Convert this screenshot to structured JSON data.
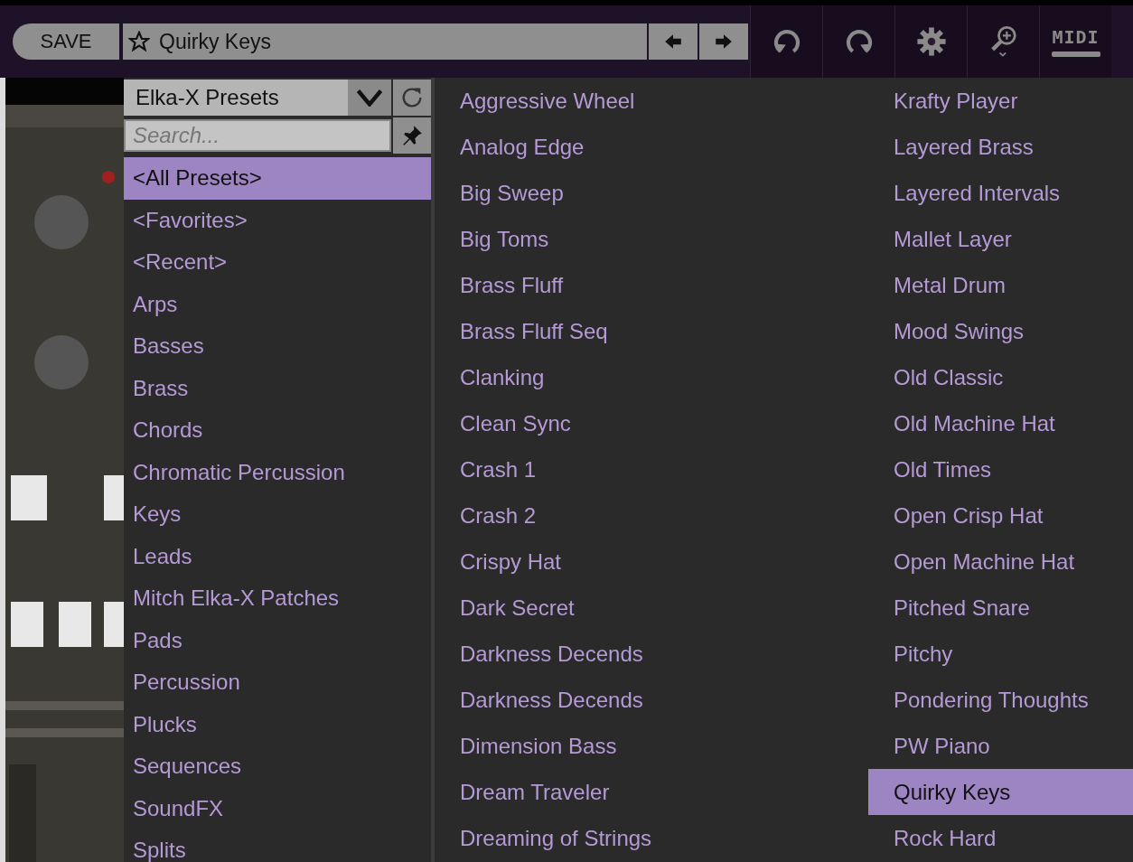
{
  "toolbar": {
    "save": "SAVE",
    "preset_name": "Quirky Keys",
    "midi_label": "MIDI"
  },
  "bank": {
    "label": "Elka-X Presets"
  },
  "search": {
    "placeholder": "Search..."
  },
  "categories": [
    {
      "label": "<All Presets>",
      "selected": true
    },
    {
      "label": "<Favorites>",
      "selected": false
    },
    {
      "label": "<Recent>",
      "selected": false
    },
    {
      "label": "Arps",
      "selected": false
    },
    {
      "label": "Basses",
      "selected": false
    },
    {
      "label": "Brass",
      "selected": false
    },
    {
      "label": "Chords",
      "selected": false
    },
    {
      "label": "Chromatic Percussion",
      "selected": false
    },
    {
      "label": "Keys",
      "selected": false
    },
    {
      "label": "Leads",
      "selected": false
    },
    {
      "label": "Mitch Elka-X Patches",
      "selected": false
    },
    {
      "label": "Pads",
      "selected": false
    },
    {
      "label": "Percussion",
      "selected": false
    },
    {
      "label": "Plucks",
      "selected": false
    },
    {
      "label": "Sequences",
      "selected": false
    },
    {
      "label": "SoundFX",
      "selected": false
    },
    {
      "label": "Splits",
      "selected": false
    }
  ],
  "presets": [
    {
      "label": "Aggressive Wheel",
      "selected": false
    },
    {
      "label": "Analog Edge",
      "selected": false
    },
    {
      "label": "Big Sweep",
      "selected": false
    },
    {
      "label": "Big Toms",
      "selected": false
    },
    {
      "label": "Brass Fluff",
      "selected": false
    },
    {
      "label": "Brass Fluff Seq",
      "selected": false
    },
    {
      "label": "Clanking",
      "selected": false
    },
    {
      "label": "Clean Sync",
      "selected": false
    },
    {
      "label": "Crash 1",
      "selected": false
    },
    {
      "label": "Crash 2",
      "selected": false
    },
    {
      "label": "Crispy Hat",
      "selected": false
    },
    {
      "label": "Dark Secret",
      "selected": false
    },
    {
      "label": "Darkness Decends",
      "selected": false
    },
    {
      "label": "Darkness Decends",
      "selected": false
    },
    {
      "label": "Dimension Bass",
      "selected": false
    },
    {
      "label": "Dream Traveler",
      "selected": false
    },
    {
      "label": "Dreaming of Strings",
      "selected": false
    },
    {
      "label": "Krafty Player",
      "selected": false
    },
    {
      "label": "Layered Brass",
      "selected": false
    },
    {
      "label": "Layered Intervals",
      "selected": false
    },
    {
      "label": "Mallet Layer",
      "selected": false
    },
    {
      "label": "Metal Drum",
      "selected": false
    },
    {
      "label": "Mood Swings",
      "selected": false
    },
    {
      "label": "Old Classic",
      "selected": false
    },
    {
      "label": "Old Machine Hat",
      "selected": false
    },
    {
      "label": "Old Times",
      "selected": false
    },
    {
      "label": "Open Crisp Hat",
      "selected": false
    },
    {
      "label": "Open Machine Hat",
      "selected": false
    },
    {
      "label": "Pitched Snare",
      "selected": false
    },
    {
      "label": "Pitchy",
      "selected": false
    },
    {
      "label": "Pondering Thoughts",
      "selected": false
    },
    {
      "label": "PW Piano",
      "selected": false
    },
    {
      "label": "Quirky Keys",
      "selected": true
    },
    {
      "label": "Rock Hard",
      "selected": false
    }
  ]
}
